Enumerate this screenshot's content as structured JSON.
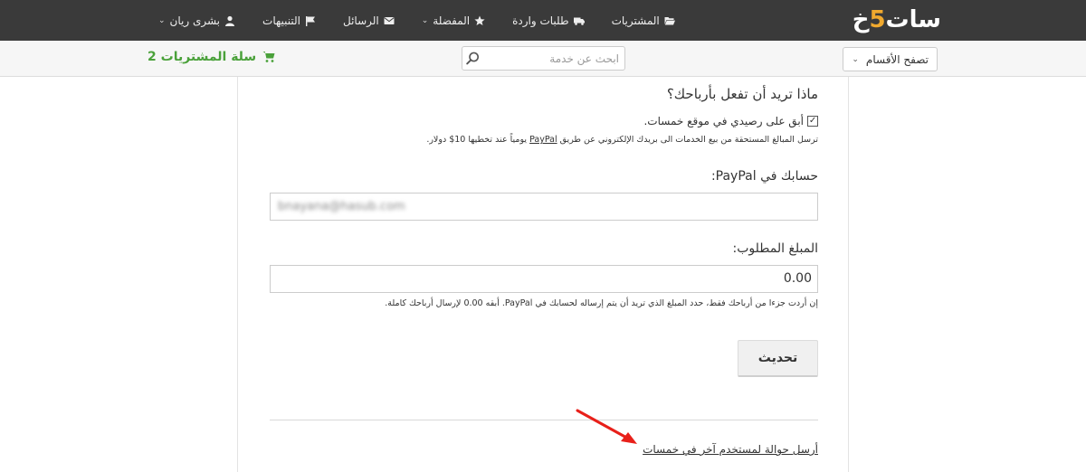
{
  "header": {
    "logo": "خمسات",
    "nav": [
      {
        "label": "بشرى ريان",
        "icon": "user-icon",
        "dropdown": true
      },
      {
        "label": "التنبيهات",
        "icon": "flag-icon",
        "dropdown": false
      },
      {
        "label": "الرسائل",
        "icon": "envelope-icon",
        "dropdown": false
      },
      {
        "label": "المفضلة",
        "icon": "star-icon",
        "dropdown": true
      },
      {
        "label": "طلبات واردة",
        "icon": "truck-icon",
        "dropdown": false
      },
      {
        "label": "المشتريات",
        "icon": "folder-open-icon",
        "dropdown": false
      }
    ]
  },
  "subbar": {
    "browse_label": "تصفح الأقسام",
    "search_placeholder": "ابحث عن خدمة",
    "cart_label": "سلة المشتريات 2"
  },
  "form": {
    "question": "ماذا تريد أن تفعل بأرباحك؟",
    "keep_balance_label": "أبق على رصيدي في موقع خمسات.",
    "keep_balance_checked": true,
    "paypal_note_before": "ترسل المبالغ المستحقة من بيع الخدمات الى بريدك الإلكتروني عن طريق",
    "paypal_link": "PayPal",
    "paypal_note_after": "يومياً عند تخطيها 10$ دولار.",
    "paypal_account_label": "حسابك في PayPal:",
    "paypal_email_value": "bnayana@hasub.com",
    "amount_label": "المبلغ المطلوب:",
    "amount_value": "0.00",
    "amount_help": "إن أردت جزءا من أرباحك فقط، حدد المبلغ الذي تريد أن يتم إرساله لحسابك في PayPal. أبقه 0.00 لإرسال أرباحك كاملة.",
    "update_button": "تحديث",
    "transfer_link": "أرسل حوالة لمستخدم آخر في خمسات"
  },
  "colors": {
    "topbar_bg": "#3a3a3a",
    "logo_accent": "#f0a92e",
    "cart_green": "#4aa13a",
    "annotation_arrow": "#e8201a"
  }
}
